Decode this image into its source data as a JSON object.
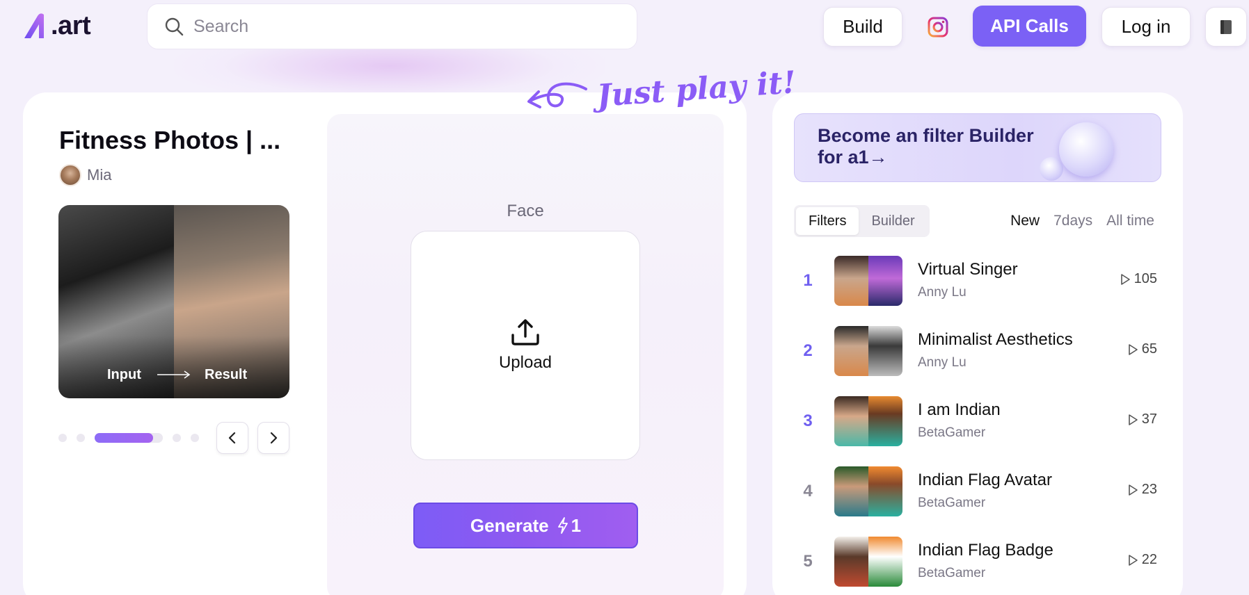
{
  "header": {
    "logo_text": ".art",
    "search_placeholder": "Search",
    "build_label": "Build",
    "api_label": "API Calls",
    "login_label": "Log in"
  },
  "filter": {
    "title": "Fitness Photos | ...",
    "author": "Mia",
    "input_label": "Input",
    "result_label": "Result"
  },
  "playground": {
    "hint": "Just play it!",
    "face_label": "Face",
    "upload_label": "Upload",
    "generate_label": "Generate",
    "generate_cost": "1"
  },
  "sidebar": {
    "banner_line1": "Become an filter Builder",
    "banner_line2": "for a1→",
    "tabs": [
      {
        "label": "Filters",
        "active": true
      },
      {
        "label": "Builder",
        "active": false
      }
    ],
    "periods": [
      {
        "label": "New",
        "active": true
      },
      {
        "label": "7days",
        "active": false
      },
      {
        "label": "All time",
        "active": false
      }
    ],
    "items": [
      {
        "rank": "1",
        "name": "Virtual Singer",
        "creator": "Anny Lu",
        "plays": "105"
      },
      {
        "rank": "2",
        "name": "Minimalist Aesthetics",
        "creator": "Anny Lu",
        "plays": "65"
      },
      {
        "rank": "3",
        "name": "I am Indian",
        "creator": "BetaGamer",
        "plays": "37"
      },
      {
        "rank": "4",
        "name": "Indian Flag Avatar",
        "creator": "BetaGamer",
        "plays": "23"
      },
      {
        "rank": "5",
        "name": "Indian Flag Badge",
        "creator": "BetaGamer",
        "plays": "22"
      }
    ]
  },
  "colors": {
    "accent": "#7b61f5",
    "rank_top": "#6f5ff0",
    "rank_other": "#8a8794"
  }
}
